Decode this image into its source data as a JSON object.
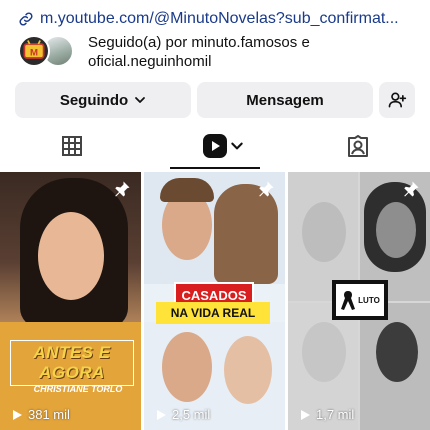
{
  "profile": {
    "link_text": "m.youtube.com/@MinutoNovelas?sub_confirmat...",
    "followed_by": "Seguido(a) por minuto.famosos e oficial.neguinhomil"
  },
  "actions": {
    "following_label": "Seguindo",
    "message_label": "Mensagem"
  },
  "tabs": [
    {
      "name": "grid",
      "icon": "grid-icon",
      "active": false
    },
    {
      "name": "reels",
      "icon": "reels-icon",
      "active": true
    },
    {
      "name": "tagged",
      "icon": "tagged-icon",
      "active": false
    }
  ],
  "posts": [
    {
      "views": "381 mil",
      "overlay_text": "ANTES E AGORA",
      "caption": "CHRISTIANE TORLO",
      "pinned": true
    },
    {
      "views": "2,5 mil",
      "banner_top": "CASADOS",
      "banner_bottom": "NA VIDA REAL",
      "pinned": true
    },
    {
      "views": "1,7 mil",
      "badge": "LUTO",
      "pinned": true
    }
  ],
  "colors": {
    "link": "#1a3a8a",
    "button_bg": "#efeff1",
    "banner_red": "#d81e1e",
    "banner_yellow": "#ffe338"
  }
}
